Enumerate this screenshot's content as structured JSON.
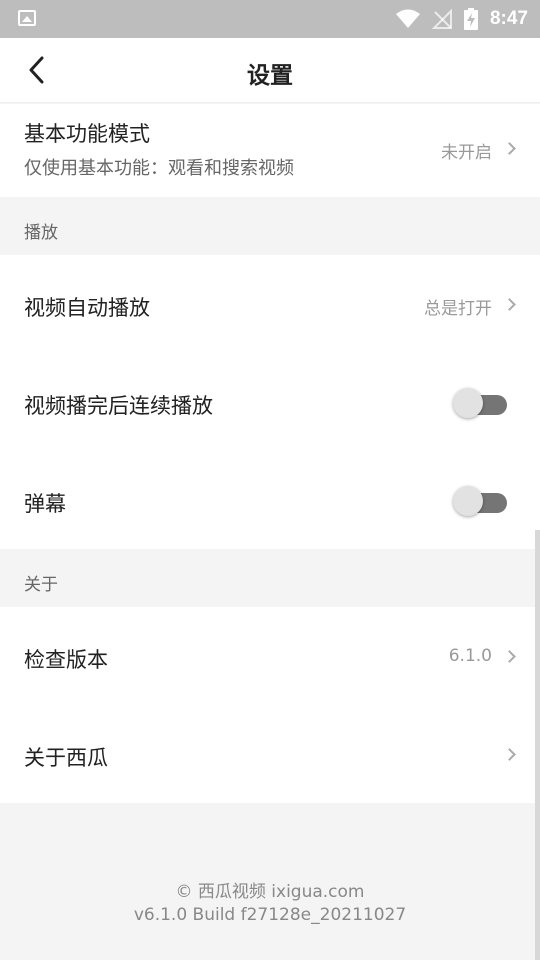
{
  "status_bar": {
    "time": "8:47"
  },
  "nav": {
    "title": "设置"
  },
  "basic_mode": {
    "title": "基本功能模式",
    "subtitle": "仅使用基本功能：观看和搜索视频",
    "value": "未开启"
  },
  "sections": {
    "playback": "播放",
    "about": "关于"
  },
  "playback": {
    "autoplay": {
      "title": "视频自动播放",
      "value": "总是打开"
    },
    "continuous": {
      "title": "视频播完后连续播放",
      "enabled": false
    },
    "danmaku": {
      "title": "弹幕",
      "enabled": false
    }
  },
  "about": {
    "check_version": {
      "title": "检查版本",
      "value": "6.1.0"
    },
    "about_xigua": {
      "title": "关于西瓜"
    }
  },
  "footer": {
    "line1": "© 西瓜视频 ixigua.com",
    "line2": "v6.1.0 Build f27128e_20211027"
  }
}
